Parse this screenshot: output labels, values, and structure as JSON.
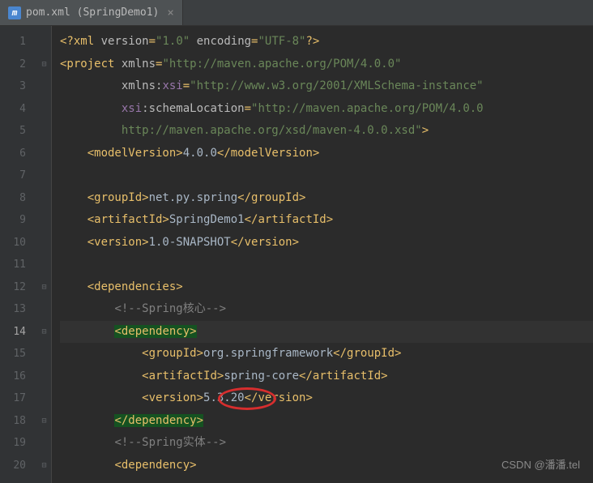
{
  "tab": {
    "icon_letter": "m",
    "title": "pom.xml (SpringDemo1)",
    "close": "×"
  },
  "gutter": [
    "1",
    "2",
    "3",
    "4",
    "5",
    "6",
    "7",
    "8",
    "9",
    "10",
    "11",
    "12",
    "13",
    "14",
    "15",
    "16",
    "17",
    "18",
    "19",
    "20"
  ],
  "active_line_idx": 13,
  "code": {
    "l1_open": "<?xml",
    "l1_version_attr": " version",
    "l1_version_val": "\"1.0\"",
    "l1_encoding_attr": " encoding",
    "l1_encoding_val": "\"UTF-8\"",
    "l1_close": "?>",
    "l2_open": "<project",
    "l2_xmlns_attr": " xmlns",
    "l2_xmlns_val": "\"http://maven.apache.org/POM/4.0.0\"",
    "l3_attr": "xmlns:",
    "l3_ns": "xsi",
    "l3_val": "\"http://www.w3.org/2001/XMLSchema-instance\"",
    "l4_ns": "xsi",
    "l4_attr": ":schemaLocation",
    "l4_val": "\"http://maven.apache.org/POM/4.0.0",
    "l5_val": "http://maven.apache.org/xsd/maven-4.0.0.xsd\"",
    "l5_close": ">",
    "l6_open": "<modelVersion>",
    "l6_text": "4.0.0",
    "l6_close": "</modelVersion>",
    "l8_open": "<groupId>",
    "l8_text": "net.py.spring",
    "l8_close": "</groupId>",
    "l9_open": "<artifactId>",
    "l9_text": "SpringDemo1",
    "l9_close": "</artifactId>",
    "l10_open": "<version>",
    "l10_text": "1.0-SNAPSHOT",
    "l10_close": "</version>",
    "l12_open": "<dependencies>",
    "l13_comment": "<!--Spring核心-->",
    "l14_open": "<dependency>",
    "l15_open": "<groupId>",
    "l15_text": "org.springframework",
    "l15_close": "</groupId>",
    "l16_open": "<artifactId>",
    "l16_text": "spring-core",
    "l16_close": "</artifactId>",
    "l17_open": "<version>",
    "l17_text": "5.3.20",
    "l17_close": "</version>",
    "l18_close": "</dependency>",
    "l19_comment": "<!--Spring实体-->",
    "l20_open": "<dependency>"
  },
  "watermark": "CSDN @潘潘.tel"
}
